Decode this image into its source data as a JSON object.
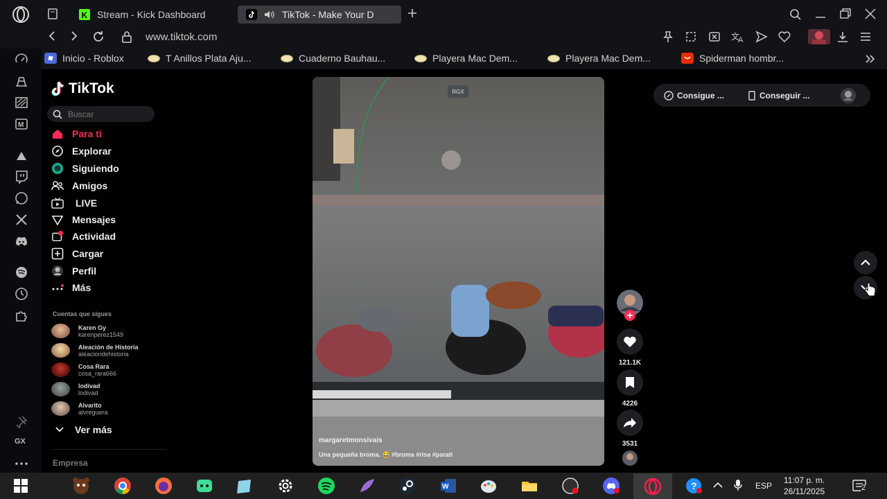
{
  "browser": {
    "tabs": [
      {
        "label": "Stream - Kick Dashboard"
      },
      {
        "label": "TikTok - Make Your D"
      }
    ],
    "url": "www.tiktok.com",
    "bookmarks": [
      {
        "label": "Inicio - Roblox"
      },
      {
        "label": "T Anillos Plata Aju..."
      },
      {
        "label": "Cuaderno Bauhau..."
      },
      {
        "label": "Playera Mac Dem..."
      },
      {
        "label": "Playera Mac Dem..."
      },
      {
        "label": "Spiderman hombr..."
      }
    ],
    "gx_label": "GX"
  },
  "tiktok": {
    "logo": "TikTok",
    "search_placeholder": "Buscar",
    "nav": [
      {
        "label": "Para ti"
      },
      {
        "label": "Explorar"
      },
      {
        "label": "Siguiendo"
      },
      {
        "label": "Amigos"
      },
      {
        "label": "LIVE"
      },
      {
        "label": "Mensajes"
      },
      {
        "label": "Actividad"
      },
      {
        "label": "Cargar"
      },
      {
        "label": "Perfil"
      },
      {
        "label": "Más"
      }
    ],
    "following_title": "Cuentas que sigues",
    "accounts": [
      {
        "name": "Karen Gy",
        "handle": "karenperez1549"
      },
      {
        "name": "Aleación de Historia",
        "handle": "aleaciondehistoria"
      },
      {
        "name": "Cosa Rara",
        "handle": "cosa_rara666"
      },
      {
        "name": "lodivad",
        "handle": "lodivad"
      },
      {
        "name": "Alvarito",
        "handle": "alvreguera"
      }
    ],
    "see_more": "Ver más",
    "company": "Empresa",
    "video": {
      "watermark": "RGX",
      "author": "margaretmonsivais",
      "caption": "Una pequeña broma. 😂 #broma #risa #parati"
    },
    "actions": {
      "likes": "121.1K",
      "saves": "4226",
      "shares": "3531"
    },
    "top_right": {
      "coins": "Consigue ...",
      "app": "Conseguir ..."
    }
  },
  "taskbar": {
    "lang": "ESP",
    "time": "11:07 p. m.",
    "date": "26/11/2025",
    "notif_count": "2"
  },
  "colors": {
    "accent": "#fe2c55",
    "kick_green": "#53fc18"
  }
}
